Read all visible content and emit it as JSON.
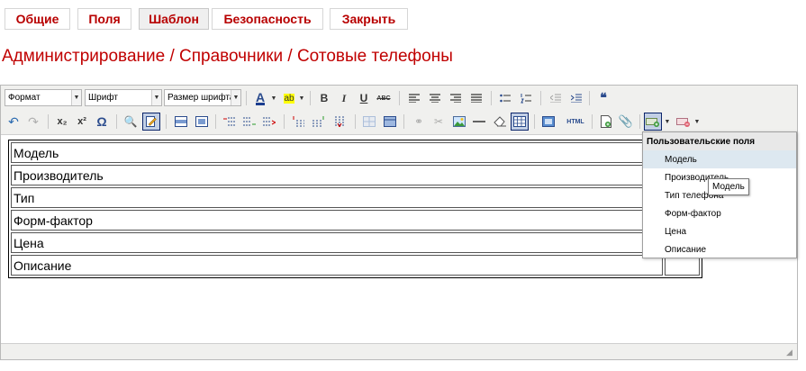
{
  "tabs": [
    {
      "label": "Общие"
    },
    {
      "label": "Поля"
    },
    {
      "label": "Шаблон",
      "active": true
    },
    {
      "label": "Безопасность"
    },
    {
      "label": "Закрыть"
    }
  ],
  "breadcrumb": "Администрирование / Справочники / Сотовые телефоны",
  "toolbar": {
    "format_select": "Формат",
    "font_select": "Шрифт",
    "size_select": "Размер шрифта",
    "bold": "B",
    "italic": "I",
    "underline": "U",
    "strike": "ABC",
    "quote": "66",
    "html": "HTML",
    "omega": "Ω",
    "subscript": "x₂",
    "superscript": "x²"
  },
  "template_rows": [
    "Модель",
    "Производитель",
    "Тип",
    "Форм-фактор",
    "Цена",
    "Описание"
  ],
  "custom_fields_menu": {
    "title": "Пользовательские поля",
    "items": [
      "Модель",
      "Производитель",
      "Тип телефона",
      "Форм-фактор",
      "Цена",
      "Описание"
    ],
    "highlighted": "Модель"
  },
  "tooltip": "Модель",
  "colors": {
    "accent": "#c00000",
    "tab_text": "#b80000",
    "highlight": "#dde8f0"
  }
}
